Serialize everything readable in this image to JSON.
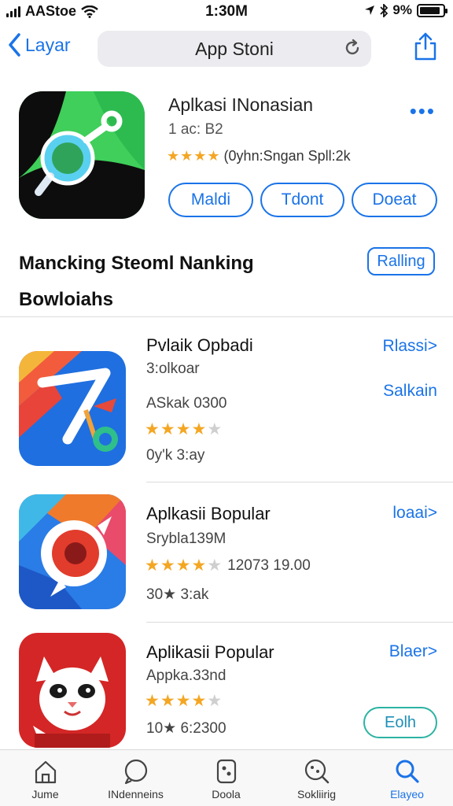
{
  "status_bar": {
    "carrier": "AAStoe",
    "time": "1:30M",
    "battery": "9%"
  },
  "nav": {
    "back_label": "Layar",
    "search_title": "App Stoni"
  },
  "featured": {
    "title": "Aplkasi INonasian",
    "subtitle": "1 ac: B2",
    "rating_stars": 4,
    "rating_text": "(0yhn:Sngan Spll:2k",
    "buttons": [
      "Maldi",
      "Tdont",
      "Doeat"
    ],
    "more": "•••"
  },
  "section": {
    "title": "Mancking Steoml Nanking Bowloiahs",
    "button": "Ralling"
  },
  "apps": [
    {
      "title": "Pvlaik Opbadi",
      "line1": "3:olkoar",
      "line2": "ASkak 0300",
      "stars": 4,
      "stars_extra": "",
      "footer": "0y'k 3:ay",
      "link": "Rlassi>",
      "link2": "Salkain",
      "pill": ""
    },
    {
      "title": "Aplkasii Bopular",
      "line1": "Srybla139M",
      "line2": "",
      "stars": 4,
      "stars_extra": "12073 19.00",
      "footer": "30★ 3:ak",
      "link": "loaai>",
      "link2": "",
      "pill": ""
    },
    {
      "title": "Aplikasii Popular",
      "line1": "Appka.33nd",
      "line2": "",
      "stars": 4,
      "stars_extra": "",
      "footer": "10★ 6:2300",
      "link": "Blaer>",
      "link2": "",
      "pill": "Eolh"
    }
  ],
  "tabs": [
    {
      "label": "Jume",
      "icon": "home-icon"
    },
    {
      "label": "INdenneins",
      "icon": "chat-icon"
    },
    {
      "label": "Doola",
      "icon": "apps-icon"
    },
    {
      "label": "Sokliirig",
      "icon": "games-icon"
    },
    {
      "label": "Elayeo",
      "icon": "search-icon"
    }
  ],
  "colors": {
    "accent": "#1a73e8",
    "star": "#f4a623",
    "teal": "#2bb3a3"
  }
}
